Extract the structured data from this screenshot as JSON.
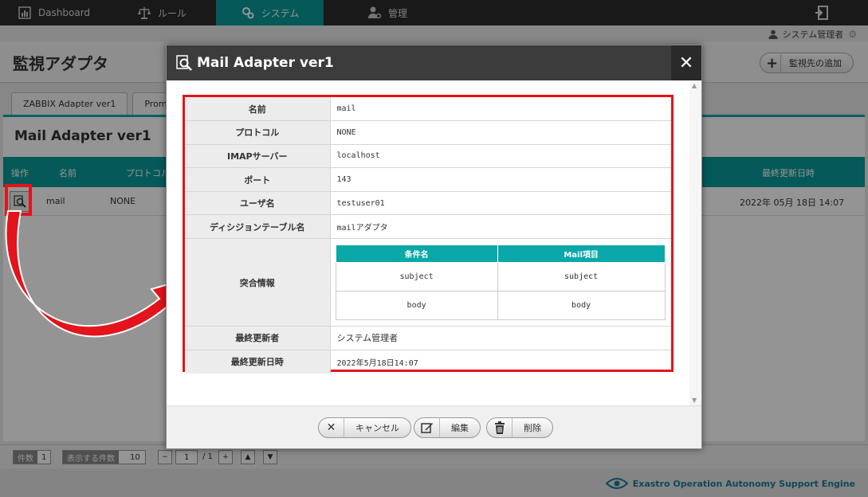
{
  "nav": {
    "items": [
      {
        "label": "Dashboard",
        "icon": "dashboard-icon"
      },
      {
        "label": "ルール",
        "icon": "scale-icon"
      },
      {
        "label": "システム",
        "icon": "gears-icon"
      },
      {
        "label": "管理",
        "icon": "user-gear-icon"
      }
    ],
    "active_index": 2
  },
  "user": {
    "name": "システム管理者"
  },
  "page": {
    "title": "監視アダプタ",
    "add_button": "監視先の追加"
  },
  "tabs": [
    "ZABBIX Adapter ver1",
    "Promet"
  ],
  "panel": {
    "title": "Mail Adapter ver1",
    "headers": [
      "操作",
      "名前",
      "プロトコル",
      "最終更新日時"
    ],
    "row": {
      "name": "mail",
      "protocol": "NONE",
      "updated": "2022年 05月 18日 14:07"
    }
  },
  "pager": {
    "count_label": "件数",
    "count_value": "1",
    "per_page_label": "表示する件数",
    "per_page_value": "10",
    "page_current": "1",
    "page_total": "/ 1"
  },
  "brand": {
    "text": "Exastro Operation Autonomy Support Engine"
  },
  "modal": {
    "title": "Mail Adapter ver1",
    "fields": [
      {
        "key": "名前",
        "value": "mail"
      },
      {
        "key": "プロトコル",
        "value": "NONE"
      },
      {
        "key": "IMAPサーバー",
        "value": "localhost"
      },
      {
        "key": "ポート",
        "value": "143"
      },
      {
        "key": "ユーザ名",
        "value": "testuser01"
      },
      {
        "key": "ディシジョンテーブル名",
        "value": "mailアダプタ"
      }
    ],
    "match": {
      "key": "突合情報",
      "headers": [
        "条件名",
        "Mail項目"
      ],
      "rows": [
        [
          "subject",
          "subject"
        ],
        [
          "body",
          "body"
        ]
      ]
    },
    "last_updater": {
      "key": "最終更新者",
      "value": "システム管理者"
    },
    "last_updated": {
      "key": "最終更新日時",
      "value": "2022年5月18日14:07"
    },
    "buttons": {
      "cancel": "キャンセル",
      "edit": "編集",
      "delete": "削除"
    }
  },
  "colors": {
    "teal": "#0a9a9a",
    "annotation_red": "#e3141b",
    "nav_bg": "#2b2b2b"
  }
}
